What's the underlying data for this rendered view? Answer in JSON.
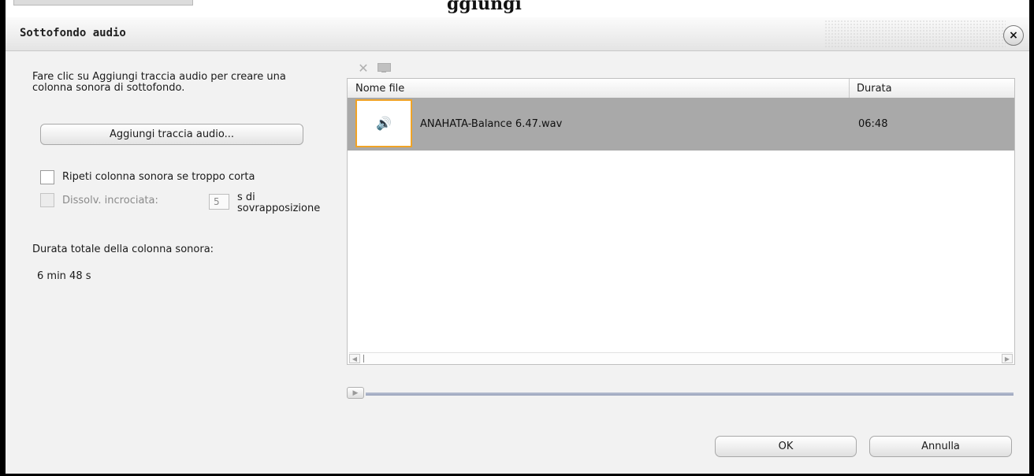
{
  "top_partial_text": "ggiungi",
  "dialog": {
    "title": "Sottofondo audio",
    "close_glyph": "×"
  },
  "left": {
    "instructions": "Fare clic su Aggiungi traccia audio per creare una colonna sonora di sottofondo.",
    "add_button": "Aggiungi traccia audio...",
    "repeat_label": "Ripeti colonna sonora se troppo corta",
    "repeat_checked": false,
    "crossfade_label": "Dissolv. incrociata:",
    "crossfade_enabled": false,
    "crossfade_value": "5",
    "overlap_label": "s di sovrapposizione",
    "total_label": "Durata totale della colonna sonora:",
    "total_value": "6 min 48 s"
  },
  "toolbar": {
    "icons": [
      "delete-icon",
      "monitor-icon"
    ],
    "delete_glyph": "✕"
  },
  "list": {
    "columns": [
      "Nome file",
      "Durata"
    ],
    "rows": [
      {
        "name": "ANAHATA-Balance 6.47.wav",
        "duration": "06:48",
        "icon": "speaker-icon",
        "icon_glyph": "🔊"
      }
    ],
    "scroll_left_glyph": "◀",
    "scroll_right_glyph": "▶"
  },
  "player": {
    "play_glyph": "▶"
  },
  "buttons": {
    "ok": "OK",
    "cancel": "Annulla"
  },
  "colors": {
    "selection": "#a9a9a9",
    "thumb_border": "#f0a326",
    "track": "#9aa3bb"
  }
}
